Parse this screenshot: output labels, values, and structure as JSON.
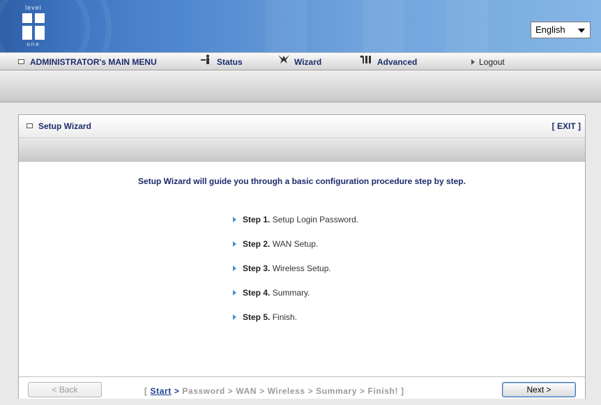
{
  "header": {
    "logo_top": "level",
    "logo_bottom": "one",
    "language": "English"
  },
  "menu": {
    "main_menu": "ADMINISTRATOR's MAIN MENU",
    "status": "Status",
    "wizard": "Wizard",
    "advanced": "Advanced",
    "logout": "Logout"
  },
  "panel": {
    "title": "Setup Wizard",
    "exit": "[ EXIT ]",
    "intro": "Setup Wizard will guide you through a basic configuration procedure step by step.",
    "steps": [
      {
        "label": "Step 1.",
        "text": "Setup Login Password."
      },
      {
        "label": "Step 2.",
        "text": "WAN Setup."
      },
      {
        "label": "Step 3.",
        "text": "Wireless Setup."
      },
      {
        "label": "Step 4.",
        "text": "Summary."
      },
      {
        "label": "Step 5.",
        "text": "Finish."
      }
    ]
  },
  "footer": {
    "back": "< Back",
    "next": "Next >",
    "crumb_open": "[",
    "crumb_current": "Start",
    "crumb_first_sep": ">",
    "crumb_rest": "Password > WAN > Wireless > Summary > Finish!",
    "crumb_close": "]"
  },
  "colors": {
    "accent": "#1b2c6b",
    "header_blue": "#3f76c2",
    "step_arrow": "#4a8ed0"
  }
}
